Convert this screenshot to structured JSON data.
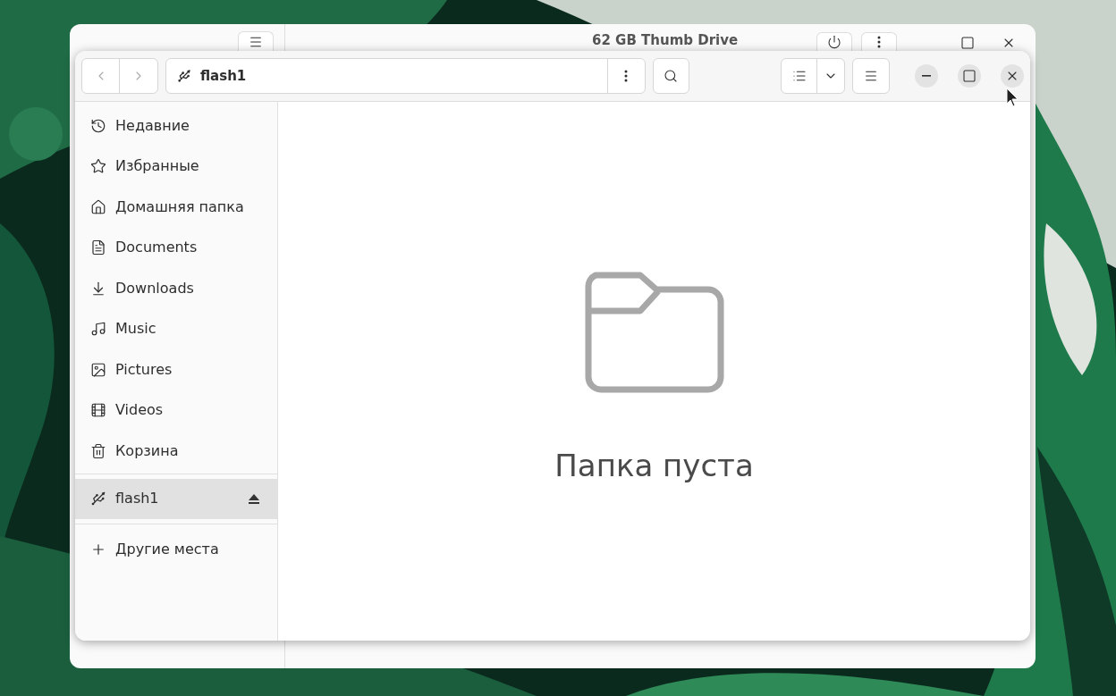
{
  "back_window": {
    "title": "62 GB Thumb Drive"
  },
  "window": {
    "location": "flash1"
  },
  "sidebar": {
    "groups": [
      [
        {
          "kind": "recent",
          "label": "Недавние",
          "selected": false
        },
        {
          "kind": "starred",
          "label": "Избранные",
          "selected": false
        },
        {
          "kind": "home",
          "label": "Домашняя папка",
          "selected": false
        },
        {
          "kind": "documents",
          "label": "Documents",
          "selected": false
        },
        {
          "kind": "downloads",
          "label": "Downloads",
          "selected": false
        },
        {
          "kind": "music",
          "label": "Music",
          "selected": false
        },
        {
          "kind": "pictures",
          "label": "Pictures",
          "selected": false
        },
        {
          "kind": "videos",
          "label": "Videos",
          "selected": false
        },
        {
          "kind": "trash",
          "label": "Корзина",
          "selected": false
        }
      ],
      [
        {
          "kind": "drive",
          "label": "flash1",
          "selected": true,
          "ejectable": true
        }
      ],
      [
        {
          "kind": "other",
          "label": "Другие места",
          "selected": false
        }
      ]
    ]
  },
  "content": {
    "empty_message": "Папка пуста"
  }
}
